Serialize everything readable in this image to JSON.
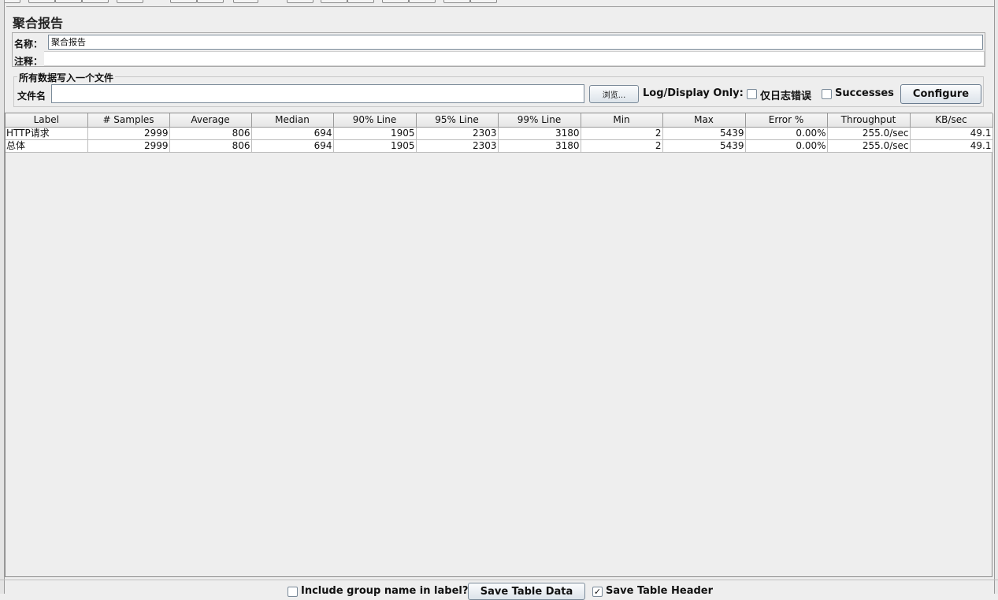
{
  "panel": {
    "title": "聚合报告",
    "name_label": "名称：",
    "name_value": "聚合报告",
    "comment_label": "注释："
  },
  "file": {
    "group_title": "所有数据写入一个文件",
    "filename_label": "文件名",
    "filename_value": "",
    "browse_label": "浏览...",
    "log_display_label": "Log/Display Only:",
    "errors_only_label": "仅日志错误",
    "errors_only_checked": false,
    "successes_label": "Successes",
    "successes_checked": false,
    "configure_label": "Configure"
  },
  "table": {
    "columns": [
      "Label",
      "# Samples",
      "Average",
      "Median",
      "90% Line",
      "95% Line",
      "99% Line",
      "Min",
      "Max",
      "Error %",
      "Throughput",
      "KB/sec"
    ],
    "rows": [
      [
        "HTTP请求",
        "2999",
        "806",
        "694",
        "1905",
        "2303",
        "3180",
        "2",
        "5439",
        "0.00%",
        "255.0/sec",
        "49.1"
      ],
      [
        "总体",
        "2999",
        "806",
        "694",
        "1905",
        "2303",
        "3180",
        "2",
        "5439",
        "0.00%",
        "255.0/sec",
        "49.1"
      ]
    ]
  },
  "bottom": {
    "include_group_label": "Include group name in label?",
    "include_group_checked": false,
    "save_table_data_label": "Save Table Data",
    "save_table_header_label": "Save Table Header",
    "save_table_header_checked": true,
    "check_mark": "✓"
  }
}
